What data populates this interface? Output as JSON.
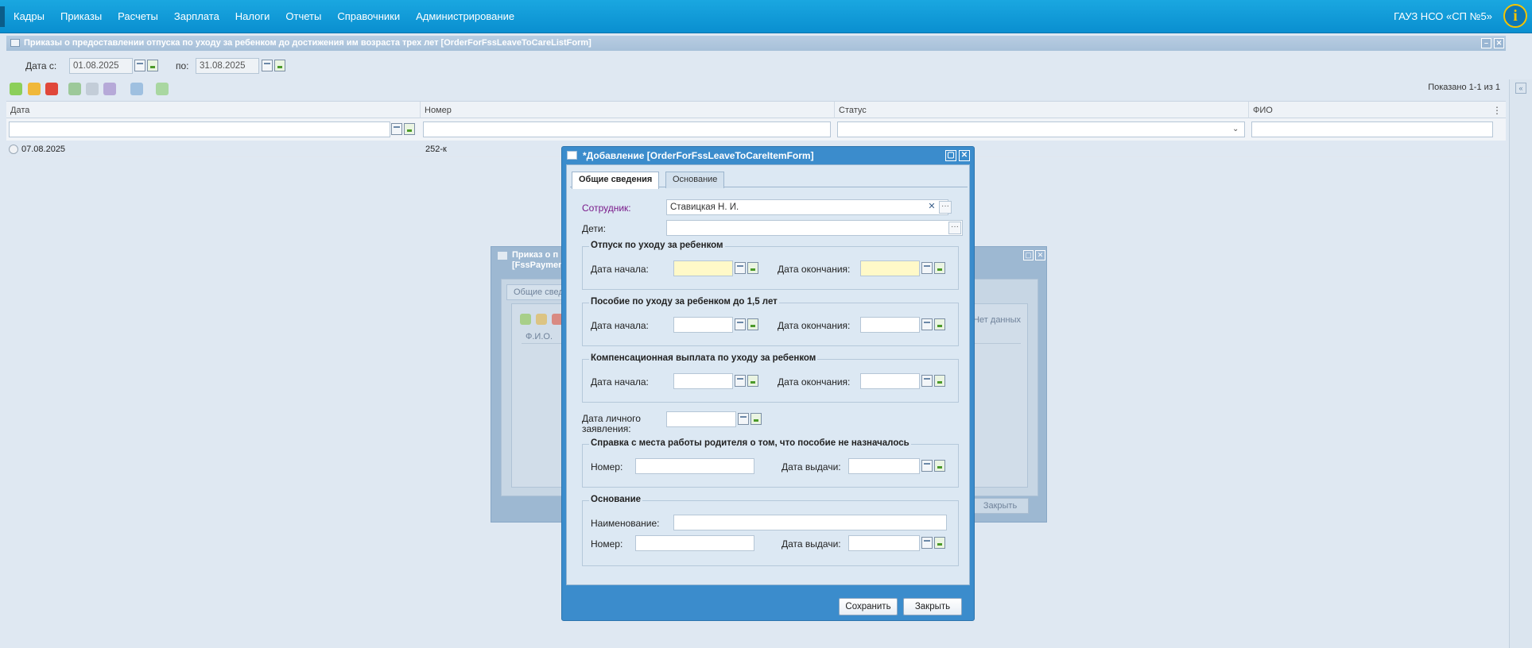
{
  "menu": [
    "Кадры",
    "Приказы",
    "Расчеты",
    "Зарплата",
    "Налоги",
    "Отчеты",
    "Справочники",
    "Администрирование"
  ],
  "org": "ГАУЗ НСО «СП №5»",
  "info_glyph": "i",
  "main": {
    "title": "Приказы о предоставлении отпуска по уходу за ребенком до достижения им возраста трех лет [OrderForFssLeaveToCareListForm]",
    "date_from_label": "Дата с:",
    "date_from": "01.08.2025",
    "date_to_label": "по:",
    "date_to": "31.08.2025",
    "shown": "Показано 1-1 из 1",
    "columns": [
      "Дата",
      "Номер",
      "Статус",
      "ФИО"
    ],
    "rows": [
      {
        "date": "07.08.2025",
        "number": "252-к",
        "status": "",
        "fio": ""
      }
    ]
  },
  "bgwin": {
    "title": "Приказ о п... [FssPaymen...",
    "title_line1": "Приказ о п",
    "title_line2": "[FssPaymen",
    "tab": "Общие сведе",
    "col": "Ф.И.О.",
    "nodata": "Нет данных",
    "close": "Закрыть"
  },
  "dialog": {
    "title": "*Добавление [OrderForFssLeaveToCareItemForm]",
    "tabs": [
      "Общие сведения",
      "Основание"
    ],
    "employee_label": "Сотрудник:",
    "employee_value": "Ставицкая Н. И.",
    "children_label": "Дети:",
    "children_value": "",
    "group1": "Отпуск по уходу за ребенком",
    "group2": "Пособие по уходу за ребенком до 1,5 лет",
    "group3": "Компенсационная выплата по уходу за ребенком",
    "start_label": "Дата начала:",
    "end_label": "Дата окончания:",
    "personal_label_1": "Дата личного",
    "personal_label_2": "заявления:",
    "group4": "Справка с места работы родителя о том, что пособие не назначалось",
    "number_label": "Номер:",
    "issue_label": "Дата выдачи:",
    "group5": "Основание",
    "name_label": "Наименование:",
    "save": "Сохранить",
    "close": "Закрыть"
  },
  "colors": {
    "accent": "#0a9ad8",
    "dialog_frame": "#3b8ccc",
    "required": "#fff9c8"
  }
}
